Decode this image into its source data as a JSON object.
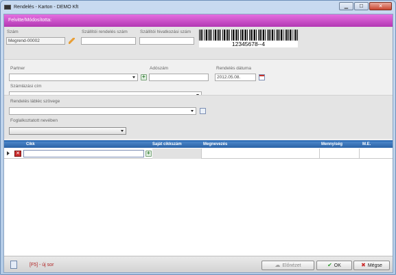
{
  "window": {
    "title": "Rendelés - Karton - DEMO Kft",
    "minimize": "▁",
    "maximize": "☐",
    "close": "✕"
  },
  "banner": {
    "text": "Felvitte/Módosította:"
  },
  "header": {
    "szam_label": "Szám",
    "szam_value": "Megrend-00002",
    "szallitoi_rendeles_label": "Szállítói rendelés szám",
    "szallitoi_rendeles_value": "",
    "szallitoi_hivatkozasi_label": "Szállítói hivatkozási szám",
    "szallitoi_hivatkozasi_value": "",
    "barcode_text": "12345678--4"
  },
  "partner_section": {
    "partner_label": "Partner",
    "partner_value": "",
    "adoszam_label": "Adószám",
    "adoszam_value": "",
    "rendeles_datuma_label": "Rendelés dátuma",
    "rendeles_datuma_value": "2012.05.08.",
    "szamlazasi_cim_label": "Számlázási cím",
    "szamlazasi_cim_value": ""
  },
  "footer_text_section": {
    "lablec_label": "Rendelés lábléc szövege",
    "lablec_value": "",
    "foglalkoztatott_label": "Foglalkoztatott nevében",
    "foglalkoztatott_value": ""
  },
  "grid": {
    "columns": [
      "Cikk",
      "Saját cikkszám",
      "Megnevezés",
      "Mennyiség",
      "M.E."
    ],
    "rows": [
      {
        "cikk": "",
        "sajat_cikkszam": "",
        "megnevezes": "",
        "mennyiseg": "",
        "me": ""
      }
    ],
    "delete_symbol": "✕"
  },
  "footer": {
    "hint": "[F5] - új sor",
    "preview_label": "Előnézet",
    "ok_label": "OK",
    "cancel_label": "Mégse"
  },
  "icons": {
    "ok": "✔",
    "cancel": "✖",
    "preview": "☁"
  },
  "colors": {
    "banner": "#c94bc9",
    "grid_header": "#2d6cb5",
    "hint_text": "#b02020"
  }
}
